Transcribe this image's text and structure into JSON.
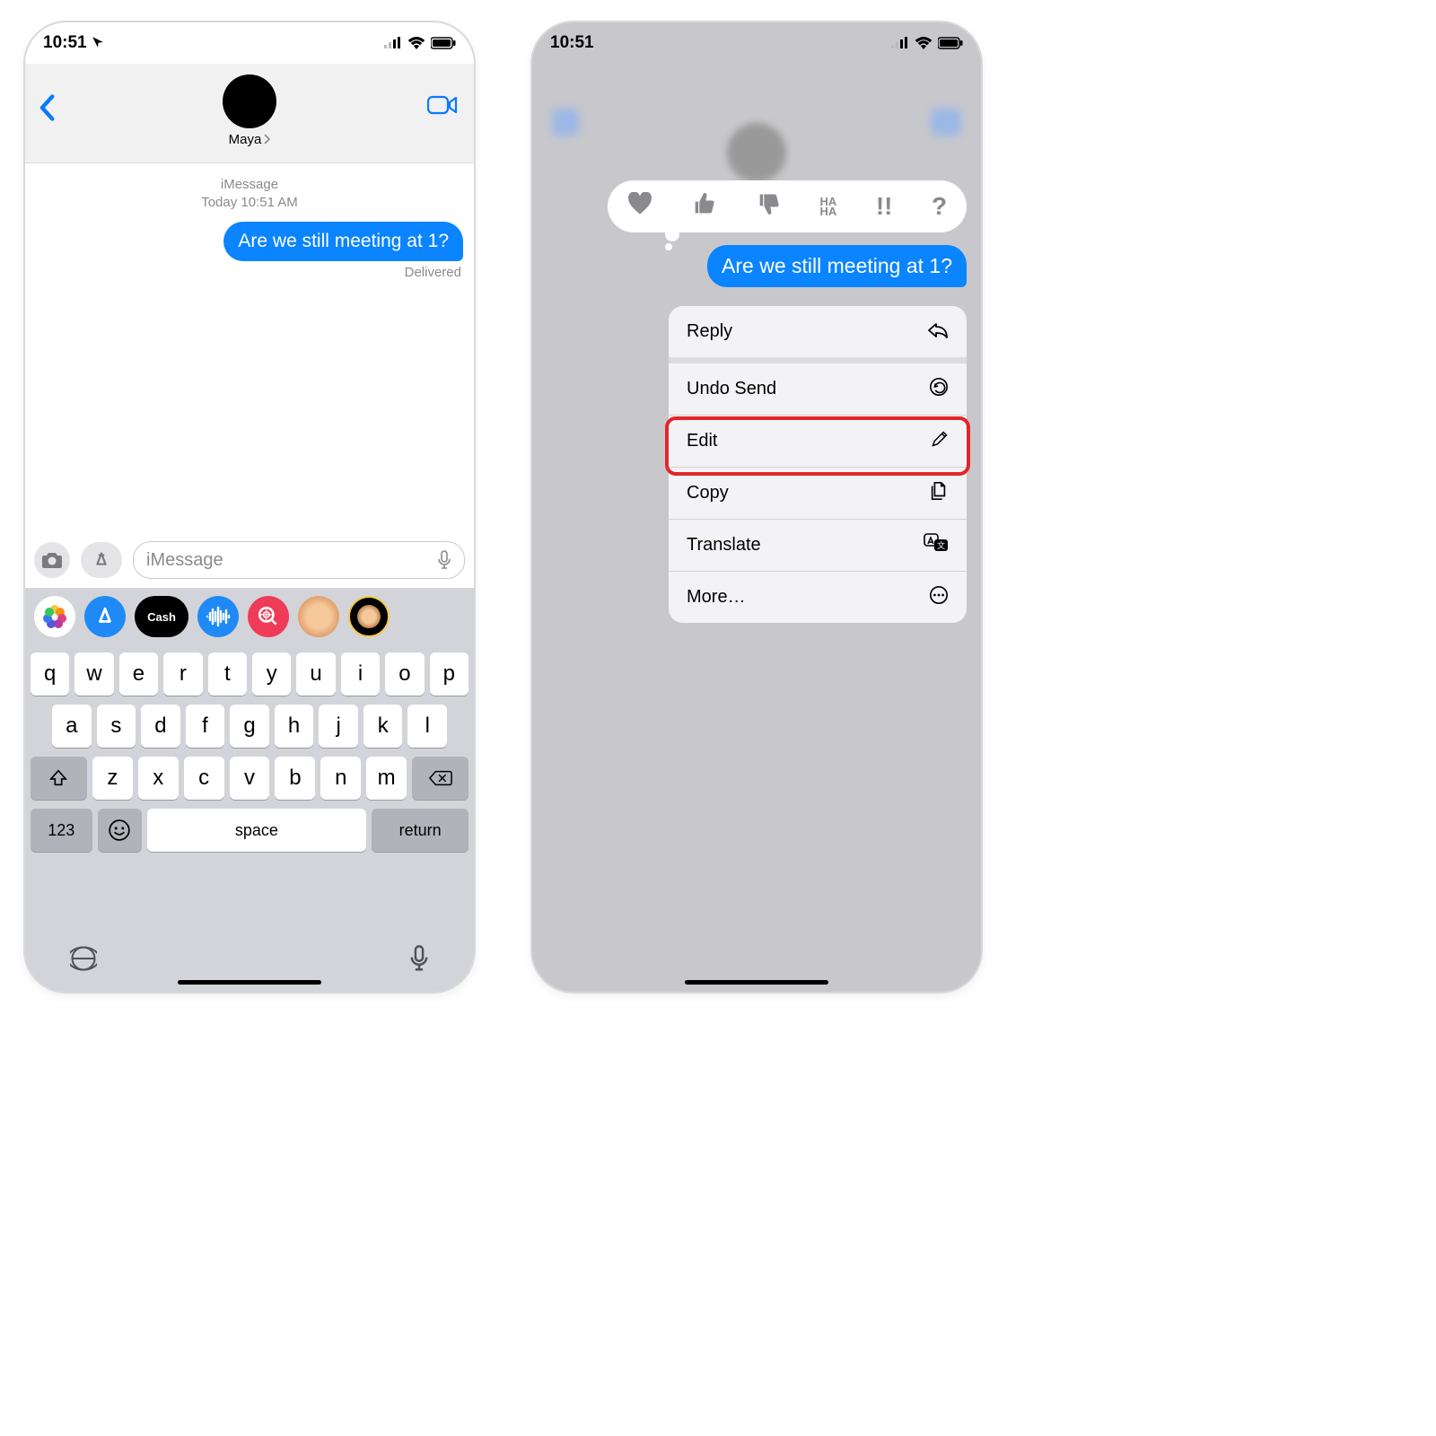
{
  "left": {
    "time": "10:51",
    "contact": "Maya",
    "meta_line1": "iMessage",
    "meta_line2": "Today 10:51 AM",
    "bubble": "Are we still meeting at 1?",
    "delivered": "Delivered",
    "placeholder": "iMessage",
    "apps": [
      "photos",
      "appstore",
      "cash",
      "audio",
      "search",
      "memoji",
      "animoji"
    ],
    "kb": {
      "r1": [
        "q",
        "w",
        "e",
        "r",
        "t",
        "y",
        "u",
        "i",
        "o",
        "p"
      ],
      "r2": [
        "a",
        "s",
        "d",
        "f",
        "g",
        "h",
        "j",
        "k",
        "l"
      ],
      "r3": [
        "z",
        "x",
        "c",
        "v",
        "b",
        "n",
        "m"
      ],
      "num": "123",
      "space": "space",
      "ret": "return"
    },
    "cash_label": "Cash"
  },
  "right": {
    "time": "10:51",
    "bubble": "Are we still meeting at 1?",
    "tapbacks": [
      "heart",
      "thumbs-up",
      "thumbs-down",
      "haha",
      "exclaim",
      "question"
    ],
    "haha": "HA\nHA",
    "exclaim": "!!",
    "question": "?",
    "menu": [
      {
        "label": "Reply",
        "icon": "reply"
      },
      {
        "label": "Undo Send",
        "icon": "undo"
      },
      {
        "label": "Edit",
        "icon": "pencil"
      },
      {
        "label": "Copy",
        "icon": "copy"
      },
      {
        "label": "Translate",
        "icon": "translate"
      },
      {
        "label": "More…",
        "icon": "more"
      }
    ]
  }
}
